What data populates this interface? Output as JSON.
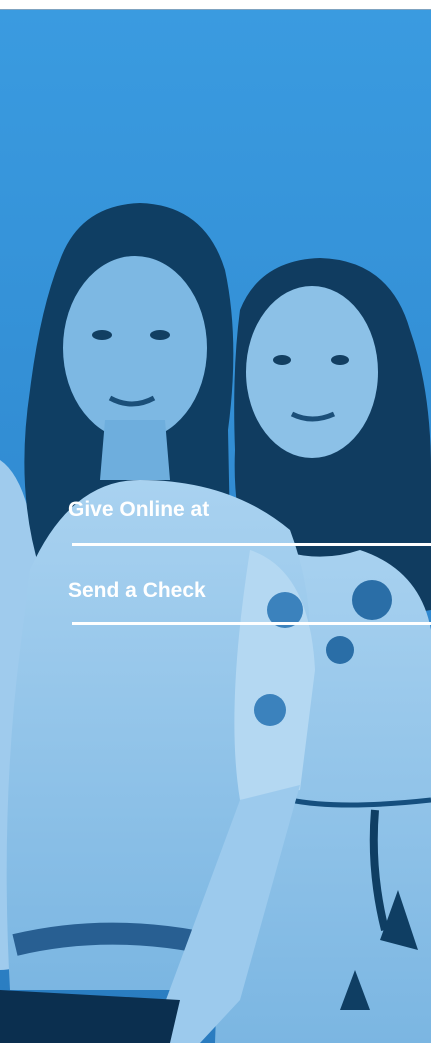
{
  "colors": {
    "background_blue": "#2f8fd6",
    "tint_dark": "#0d3a5e",
    "tint_light": "#cfe6f7",
    "text": "#ffffff"
  },
  "options": [
    {
      "label": "Give Online at"
    },
    {
      "label": "Send a Check"
    }
  ]
}
